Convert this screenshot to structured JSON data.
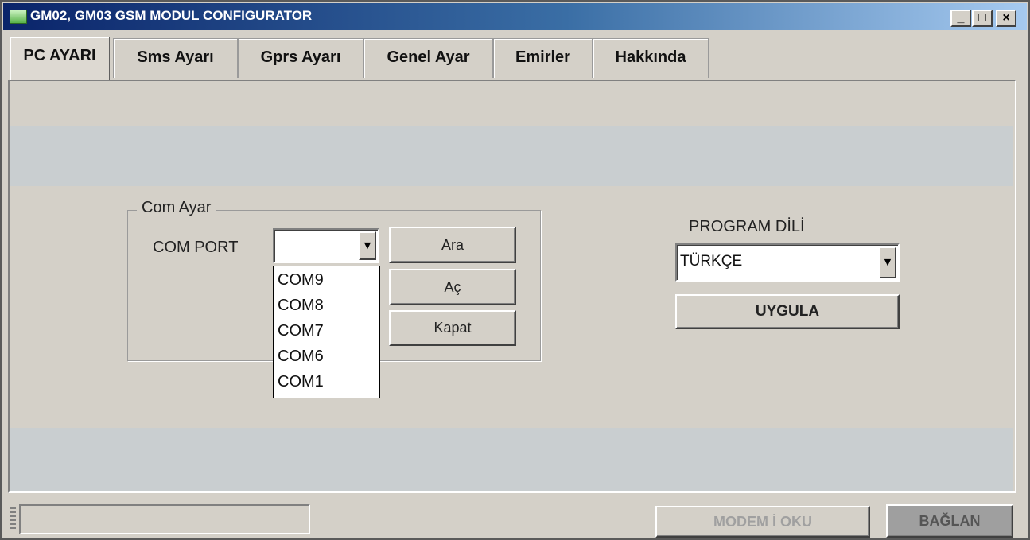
{
  "window": {
    "title": "GM02, GM03 GSM MODUL CONFIGURATOR",
    "app_icon": "app-icon",
    "controls": {
      "minimize": "_",
      "maximize": "□",
      "close": "×"
    }
  },
  "tabs": [
    {
      "label": "PC AYARI",
      "active": true
    },
    {
      "label": "Sms Ayarı",
      "active": false
    },
    {
      "label": "Gprs Ayarı",
      "active": false
    },
    {
      "label": "Genel Ayar",
      "active": false
    },
    {
      "label": "Emirler",
      "active": false
    },
    {
      "label": "Hakkında",
      "active": false
    }
  ],
  "com_group": {
    "title": "Com Ayar",
    "com_port_label": "COM PORT",
    "com_port_value": "",
    "com_port_options": [
      "COM9",
      "COM8",
      "COM7",
      "COM6",
      "COM1"
    ],
    "buttons": {
      "search": "Ara",
      "open": "Aç",
      "close": "Kapat"
    }
  },
  "language": {
    "label": "PROGRAM DİLİ",
    "selected": "TÜRKÇE",
    "apply_button": "UYGULA"
  },
  "statusbar": {
    "status_text": "",
    "read_modem_button": "MODEM İ OKU",
    "connect_button": "BAĞLAN"
  },
  "colors": {
    "title_bar_start": "#0a246a",
    "title_bar_end": "#a6caf0",
    "window_face": "#d4d0c8",
    "band": "#c9ced0"
  }
}
